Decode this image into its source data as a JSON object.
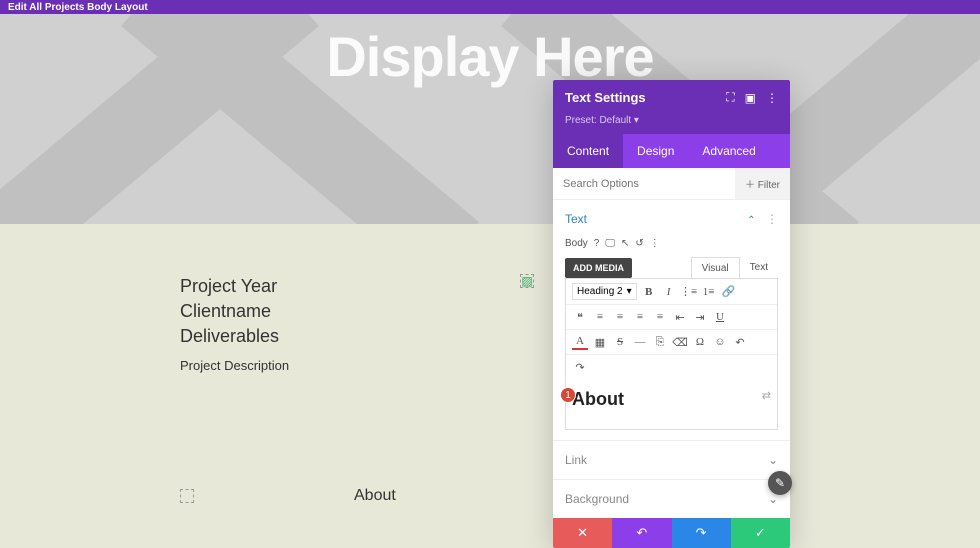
{
  "topbar": {
    "title": "Edit All Projects Body Layout"
  },
  "hero": {
    "heading": "Display Here"
  },
  "meta": {
    "line1": "Project Year",
    "line2": "Clientname",
    "line3": "Deliverables",
    "desc": "Project Description"
  },
  "lower": {
    "about": "About"
  },
  "panel": {
    "title": "Text Settings",
    "preset": "Preset: Default ▾",
    "tabs": {
      "content": "Content",
      "design": "Design",
      "advanced": "Advanced"
    },
    "search_placeholder": "Search Options",
    "filter": "＋ Filter",
    "text_label": "Text",
    "body_label": "Body",
    "add_media": "ADD MEDIA",
    "visual": "Visual",
    "texttab": "Text",
    "heading_sel": "Heading 2",
    "editor_content": "About",
    "link": "Link",
    "background": "Background",
    "marker": "1"
  },
  "icons": {
    "expand": "⛶",
    "square": "▣",
    "more": "⋮",
    "help": "?",
    "desktop": "🖵",
    "hover": "↖",
    "reset": "↺",
    "dots": "⋮",
    "bold": "B",
    "italic": "I",
    "ul": "⋮≡",
    "ol": "1≡",
    "link": "🔗",
    "quote": "❝",
    "alignl": "≡",
    "alignc": "≡",
    "alignr": "≡",
    "alignj": "≡",
    "indent": "⇥",
    "outdent": "⇤",
    "underline": "U",
    "color": "A",
    "img": "▦",
    "strike": "S",
    "hr": "—",
    "ins": "⎘",
    "clear": "⌫",
    "omega": "Ω",
    "emoji": "☺",
    "undo": "↶",
    "redo": "↷",
    "close": "✕",
    "undo2": "↶",
    "redo2": "↷",
    "check": "✓",
    "chev_up": "⌃",
    "chev_down": "⌄",
    "dynamic": "⇄",
    "edit": "✎"
  }
}
